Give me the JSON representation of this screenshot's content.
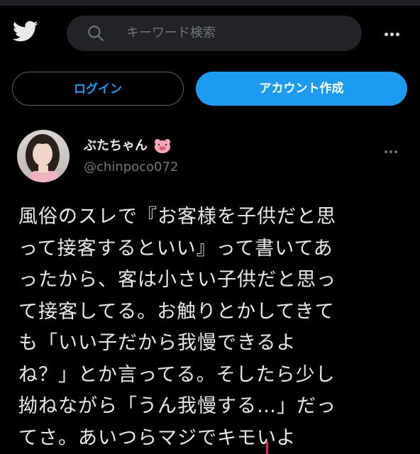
{
  "search": {
    "placeholder": "キーワード検索"
  },
  "buttons": {
    "login": "ログイン",
    "signup": "アカウント作成"
  },
  "tweet": {
    "display_name": "ぶたちゃん",
    "handle": "@chinpoco072",
    "lines": [
      "風俗のスレで『お客様を子供だと思",
      "って接客するといい』って書いてあ",
      "ったから、客は小さい子供だと思っ",
      "て接客してる。お触りとかしてきて",
      "も「いい子だから我慢できるよ",
      "ね？」とか言ってる。そしたら少し",
      "拗ねながら「うん我慢する…」だっ",
      "てさ。あいつらマジでキモいよ"
    ]
  },
  "icons": {
    "logo": "twitter-bird-icon",
    "search": "search-icon",
    "more": "more-horizontal-icon",
    "emoji": "pig-face-emoji"
  },
  "colors": {
    "accent": "#1d9bf0",
    "background": "#000000",
    "secondary_text": "#71767b"
  }
}
